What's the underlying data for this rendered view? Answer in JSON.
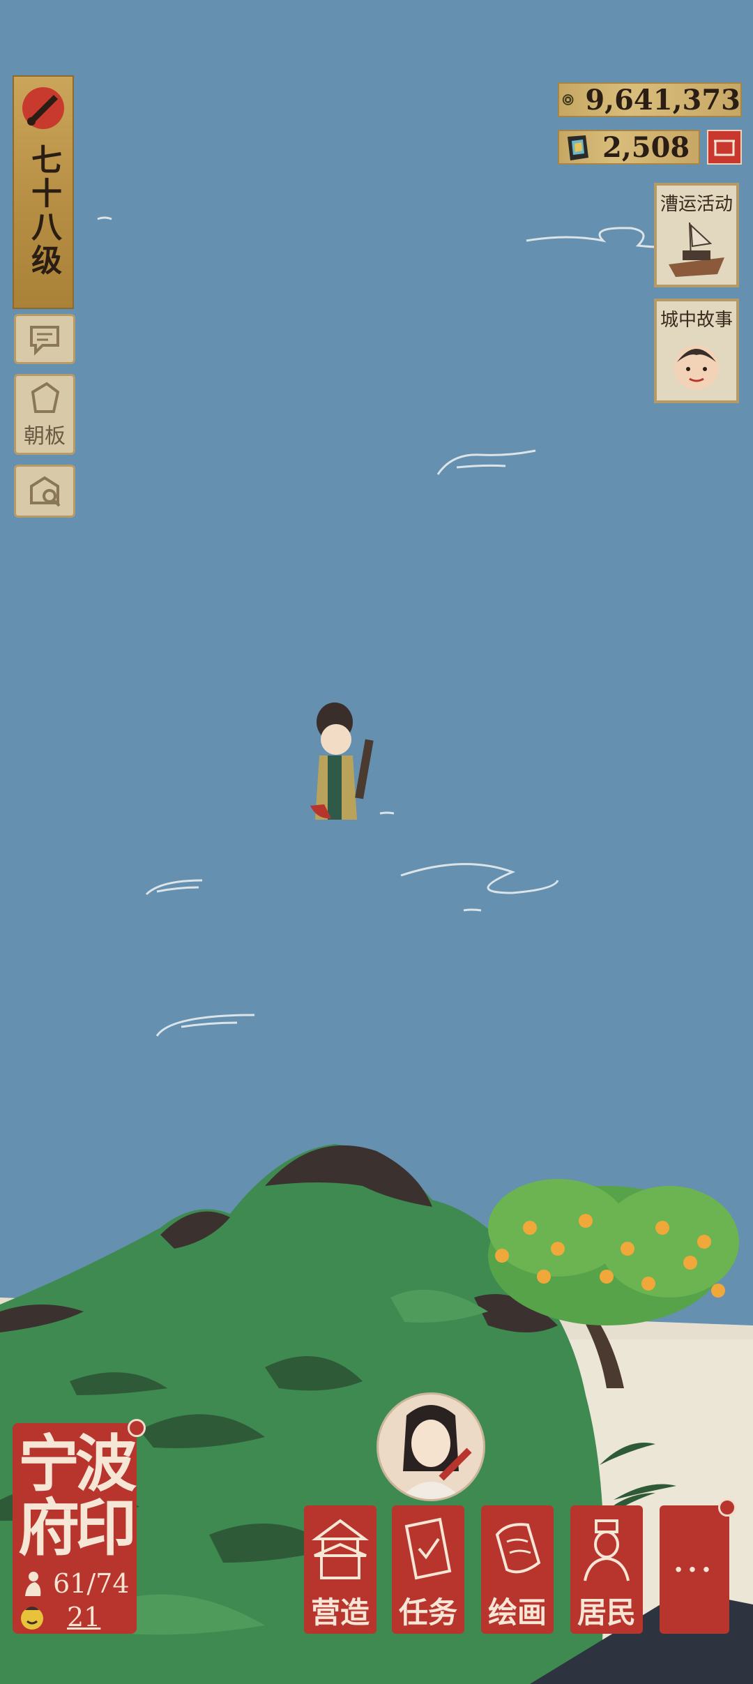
{
  "player": {
    "level_text": "七十八级"
  },
  "currencies": {
    "coins": "9,641,373",
    "jade": "2,508"
  },
  "left_menu": {
    "board_label": "朝板"
  },
  "events": [
    {
      "title": "漕运活动"
    },
    {
      "title": "城中故事"
    }
  ],
  "city": {
    "name": "宁波府印",
    "population": "61/74",
    "happiness": "21"
  },
  "nav": {
    "build": "营造",
    "tasks": "任务",
    "paint": "绘画",
    "residents": "居民",
    "more": "···"
  },
  "colors": {
    "sky": "#6590b0",
    "seal_red": "#b8352e",
    "gold": "#c6a863",
    "mountain_green": "#3e8a50"
  },
  "icons": [
    "brush-icon",
    "chat-icon",
    "board-icon",
    "market-search-icon",
    "coin-icon",
    "jade-icon",
    "shop-icon",
    "boat-icon",
    "child-face-icon",
    "build-icon",
    "task-icon",
    "paint-icon",
    "resident-icon",
    "population-icon",
    "happiness-icon"
  ]
}
